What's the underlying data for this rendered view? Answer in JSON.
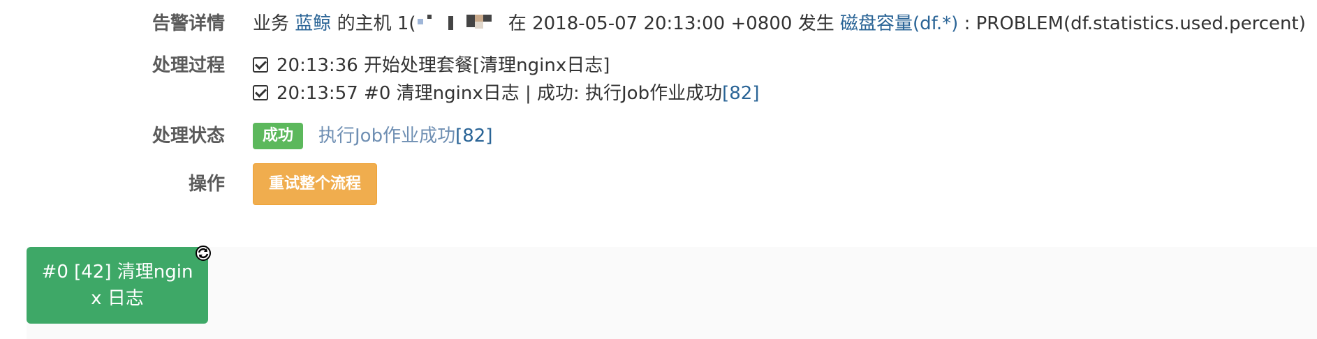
{
  "labels": {
    "alert_detail": "告警详情",
    "process": "处理过程",
    "status": "处理状态",
    "action": "操作"
  },
  "alert": {
    "prefix_business": "业务",
    "business_name": "蓝鲸",
    "host_label": "的主机",
    "host_visible": "1(",
    "at_word": "在",
    "time": "2018-05-07 20:13:00 +0800",
    "happen_word": "发生",
    "metric": "磁盘容量(df.*)",
    "result": ": PROBLEM(df.statistics.used.percent)"
  },
  "process_steps": [
    {
      "text": "20:13:36 开始处理套餐[清理nginx日志]",
      "link": ""
    },
    {
      "text": "20:13:57 #0 清理nginx日志 | 成功: 执行Job作业成功",
      "link": "[82]"
    }
  ],
  "status": {
    "badge": "成功",
    "text": "执行Job作业成功",
    "link": "[82]"
  },
  "action": {
    "retry_label": "重试整个流程"
  },
  "flow": {
    "node_label": "#0 [42] 清理nginx 日志"
  },
  "icons": {
    "check": "check-square-icon",
    "refresh": "refresh-icon"
  },
  "colors": {
    "success": "#5cb85c",
    "warning": "#f0ad4e",
    "link": "#2a6496",
    "flow_node": "#3ea867"
  }
}
